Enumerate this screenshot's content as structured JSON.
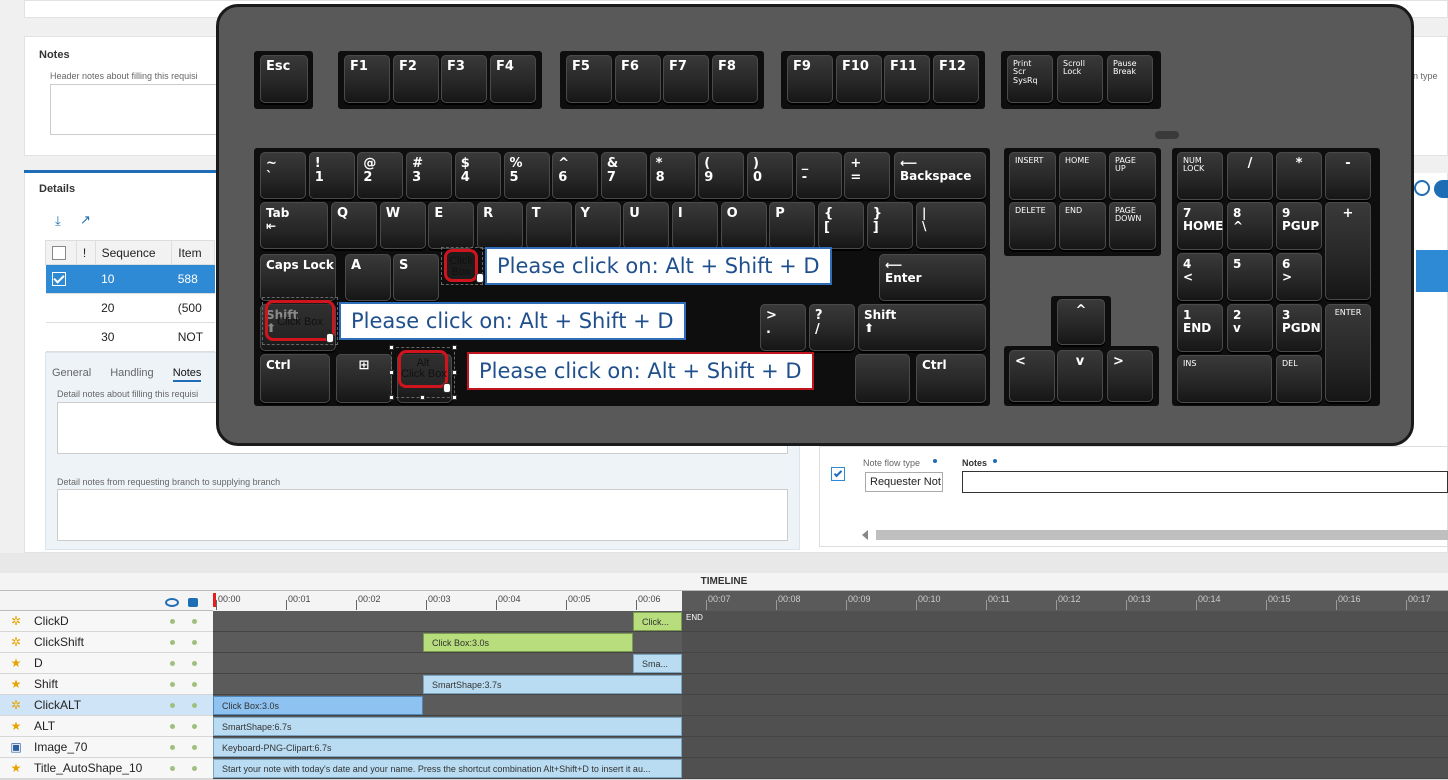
{
  "form": {
    "notes_title": "Notes",
    "notes_hint": "Header notes about filling this requisi",
    "right_hint": "n type",
    "details_title": "Details",
    "grid": {
      "headers": [
        "",
        "!",
        "Sequence",
        "Item"
      ],
      "rows": [
        {
          "checked": true,
          "sequence": "10",
          "item": "588"
        },
        {
          "checked": false,
          "sequence": "20",
          "item": "(500"
        },
        {
          "checked": false,
          "sequence": "30",
          "item": "NOT"
        }
      ]
    },
    "subtabs": [
      "General",
      "Handling",
      "Notes"
    ],
    "detail_notes_hint": "Detail notes about filling this requisi",
    "detail_notes_branch_hint": "Detail notes from requesting branch to supplying branch",
    "note_flow_type_label": "Note flow type",
    "note_flow_type_value": "Requester Not",
    "notes_label": "Notes"
  },
  "keyboard": {
    "row_fn": [
      "Esc",
      "F1",
      "F2",
      "F3",
      "F4",
      "F5",
      "F6",
      "F7",
      "F8",
      "F9",
      "F10",
      "F11",
      "F12"
    ],
    "sys_keys": [
      "Print\nScr\nSysRq",
      "Scroll\nLock",
      "Pause\nBreak"
    ],
    "row1": [
      "~\n`",
      "!\n1",
      "@\n2",
      "#\n3",
      "$\n4",
      "%\n5",
      "^\n6",
      "&\n7",
      "*\n8",
      "(\n9",
      ")\n0",
      "_\n-",
      "+\n=",
      "⟵\nBackspace"
    ],
    "row2": [
      "Tab\n⇤",
      "Q",
      "W",
      "E",
      "R",
      "T",
      "Y",
      "U",
      "I",
      "O",
      "P",
      "{\n[",
      "}\n]",
      "|\n\\"
    ],
    "row3": [
      "Caps Lock",
      "A",
      "S",
      "",
      "",
      "",
      "",
      "",
      "",
      "",
      "",
      "⟵\nEnter"
    ],
    "row4": [
      "Shift\n⬆",
      "",
      "",
      "",
      "",
      "",
      "",
      "",
      "<\n,",
      ">\n.",
      "?\n/",
      "Shift\n⬆"
    ],
    "row5": [
      "Ctrl",
      "⊞",
      "",
      "",
      "Ctrl"
    ],
    "nav": [
      "INSERT",
      "HOME",
      "PAGE\nUP",
      "DELETE",
      "END",
      "PAGE\nDOWN"
    ],
    "arrows": [
      "^",
      "<",
      "v",
      ">"
    ],
    "numpad": [
      "NUM\nLOCK",
      "/",
      "*",
      "-",
      "7\nHOME",
      "8\n^",
      "9\nPGUP",
      "+",
      "4\n<",
      "5",
      "6\n>",
      "1\nEND",
      "2\nv",
      "3\nPGDN",
      "ENTER",
      "INS",
      "DEL"
    ]
  },
  "click_boxes": [
    {
      "key": "D",
      "label": "Click\nBox"
    },
    {
      "key": "Shift",
      "label": "Click Box"
    },
    {
      "key": "Alt",
      "label": "Alt\nClick Box"
    }
  ],
  "captions": [
    "Please click on: Alt + Shift + D",
    "Please click on: Alt + Shift + D",
    "Please click on: Alt + Shift + D"
  ],
  "timeline": {
    "title": "TIMELINE",
    "ticks": [
      "00:00",
      "00:01",
      "00:02",
      "00:03",
      "00:04",
      "00:05",
      "00:06",
      "00:07",
      "00:08",
      "00:09",
      "00:10",
      "00:11",
      "00:12",
      "00:13",
      "00:14",
      "00:15",
      "00:16",
      "00:17"
    ],
    "end_label": "END",
    "layers": [
      {
        "name": "ClickD",
        "icon": "click-box-icon",
        "bar": "Click...",
        "start_s": 6.0,
        "duration_s": 0.7,
        "kind": "green"
      },
      {
        "name": "ClickShift",
        "icon": "click-box-icon",
        "bar": "Click Box:3.0s",
        "start_s": 3.0,
        "duration_s": 3.0,
        "kind": "green"
      },
      {
        "name": "D",
        "icon": "smart-shape-icon",
        "bar": "Sma...",
        "start_s": 6.0,
        "duration_s": 0.7,
        "kind": "blue"
      },
      {
        "name": "Shift",
        "icon": "smart-shape-icon",
        "bar": "SmartShape:3.7s",
        "start_s": 3.0,
        "duration_s": 3.7,
        "kind": "blue"
      },
      {
        "name": "ClickALT",
        "icon": "click-box-icon",
        "bar": "Click Box:3.0s",
        "start_s": 0.0,
        "duration_s": 3.0,
        "kind": "sel"
      },
      {
        "name": "ALT",
        "icon": "smart-shape-icon",
        "bar": "SmartShape:6.7s",
        "start_s": 0.0,
        "duration_s": 6.7,
        "kind": "blue"
      },
      {
        "name": "Image_70",
        "icon": "image-icon",
        "bar": "Keyboard-PNG-Clipart:6.7s",
        "start_s": 0.0,
        "duration_s": 6.7,
        "kind": "blue"
      },
      {
        "name": "Title_AutoShape_10",
        "icon": "smart-shape-icon",
        "bar": "Start your note with today's date and your name. Press the shortcut combination Alt+Shift+D to insert it au...",
        "start_s": 0.0,
        "duration_s": 6.7,
        "kind": "blue"
      }
    ]
  }
}
